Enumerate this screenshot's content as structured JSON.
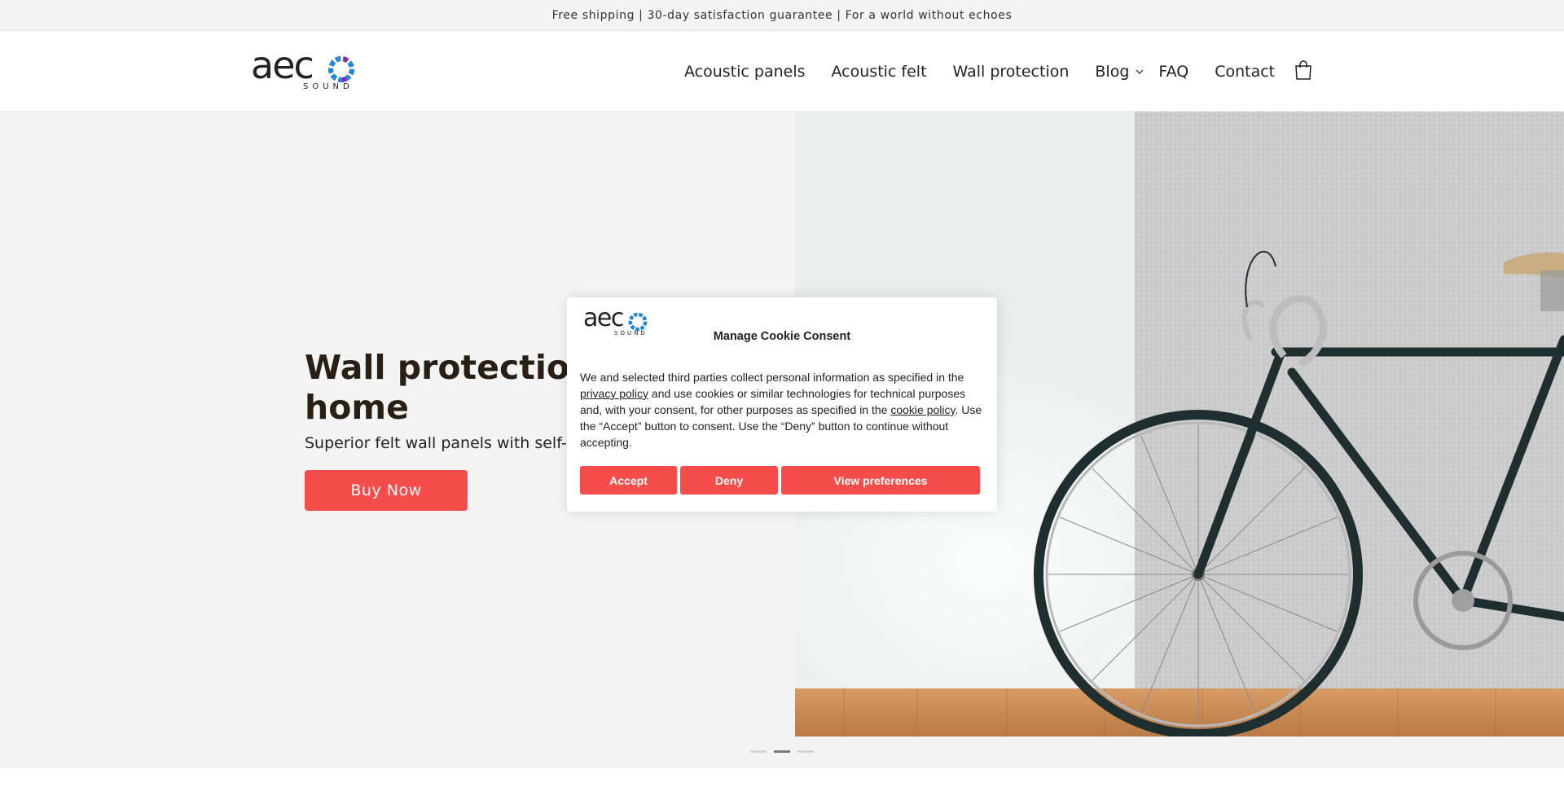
{
  "announcement": {
    "text": "Free shipping | 30-day satisfaction guarantee | For a world without echoes"
  },
  "header": {
    "logo": {
      "word": "aec",
      "sub": "SOUND"
    },
    "nav": [
      {
        "label": "Acoustic panels"
      },
      {
        "label": "Acoustic felt"
      },
      {
        "label": "Wall protection"
      },
      {
        "label": "Blog",
        "has_dropdown": true
      },
      {
        "label": "FAQ"
      },
      {
        "label": "Contact"
      }
    ],
    "cart_icon": "shopping-bag-icon"
  },
  "hero": {
    "title": "Wall protection for your home",
    "title_visible": "Wall protection",
    "title_line2": "home",
    "subtitle": "Superior felt wall panels with self-ac",
    "button_label": "Buy Now",
    "slides": {
      "count": 3,
      "active": 2
    }
  },
  "cookie": {
    "title": "Manage Cookie Consent",
    "body_part1": "We and selected third parties collect personal information as specified in the ",
    "privacy_link": "privacy policy",
    "body_part2": " and use cookies or similar technologies for technical purposes and, with your consent, for other purposes as specified in the ",
    "cookie_link": "cookie policy",
    "body_part3": ". Use the “Accept” button to consent. Use the “Deny” button to continue without accepting.",
    "accept_label": "Accept",
    "deny_label": "Deny",
    "preferences_label": "View preferences"
  },
  "colors": {
    "accent": "#f54c4c",
    "title": "#2a1f15",
    "hero_bg": "#f4f4f4"
  }
}
